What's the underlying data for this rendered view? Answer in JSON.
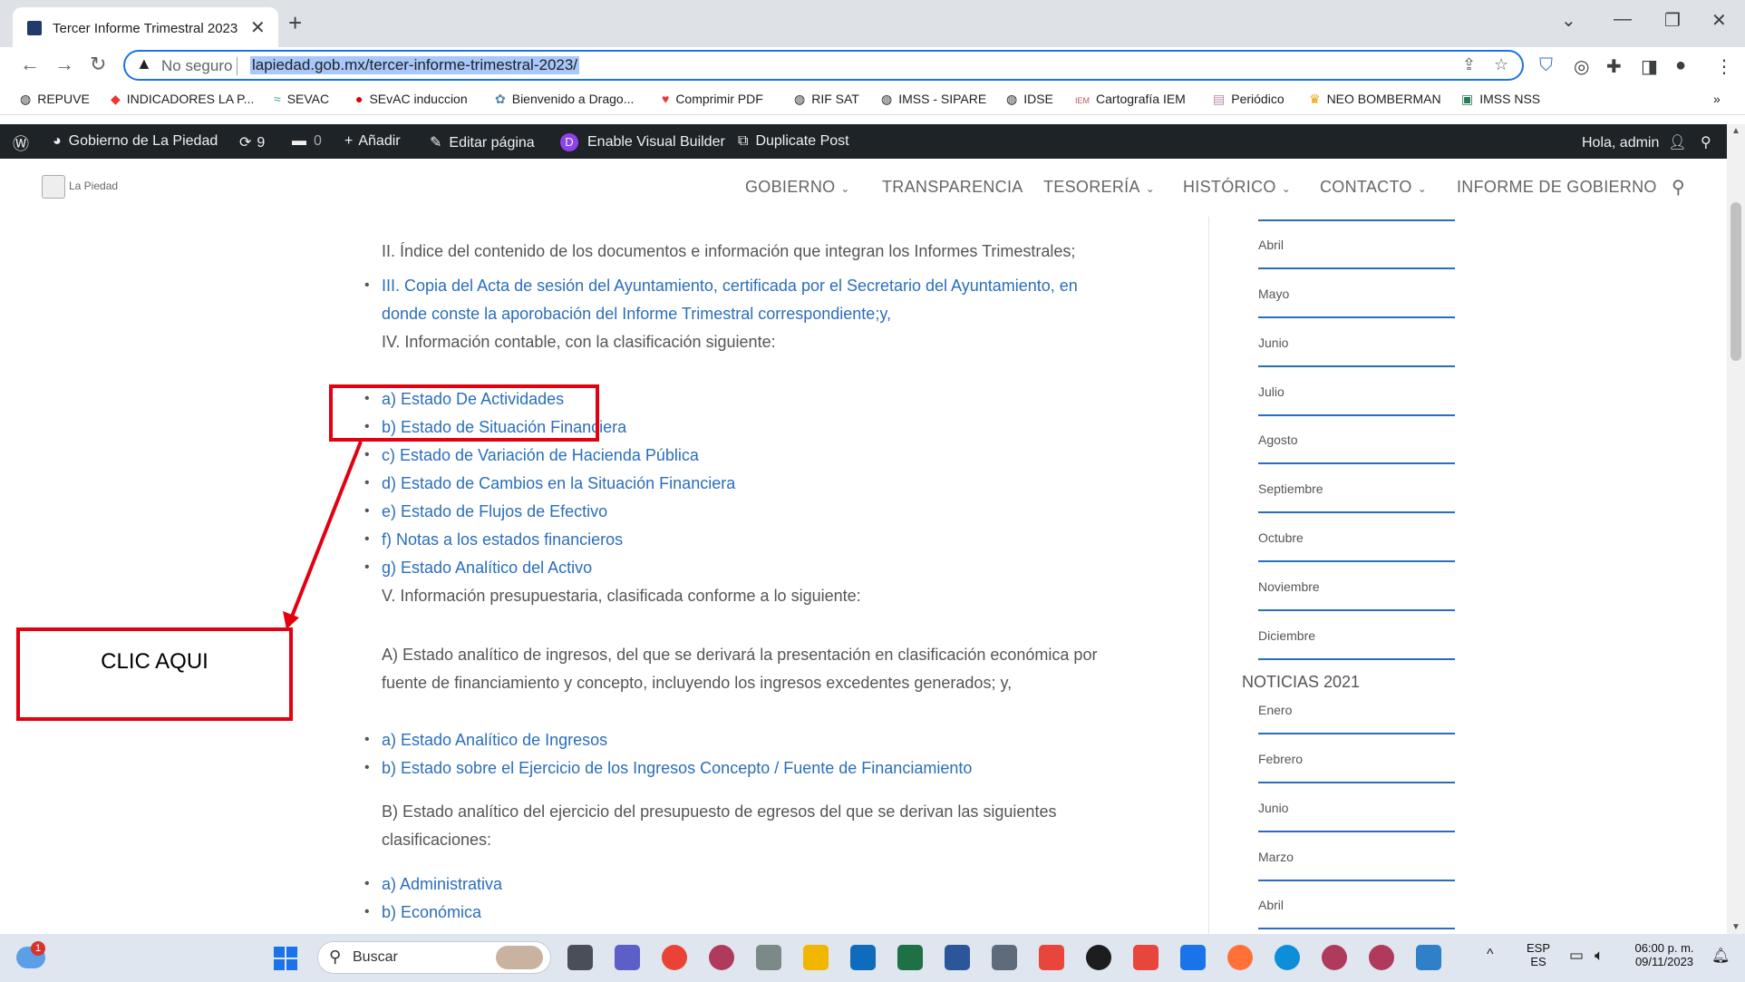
{
  "browser": {
    "tab_title": "Tercer Informe Trimestral 2023 |",
    "security_label": "No seguro",
    "url": "lapiedad.gob.mx/tercer-informe-trimestral-2023/",
    "bookmarks": [
      "REPUVE",
      "INDICADORES LA P...",
      "SEVAC",
      "SEvAC induccion",
      "Bienvenido a Drago...",
      "Comprimir PDF",
      "RIF SAT",
      "IMSS - SIPARE",
      "IDSE",
      "Cartografía IEM",
      "Periódico",
      "NEO BOMBERMAN",
      "IMSS NSS"
    ],
    "bookmarks_overflow": "»"
  },
  "adminbar": {
    "site_name": "Gobierno de La Piedad",
    "updates_count": "9",
    "comments_count": "0",
    "add_new": "Añadir",
    "edit_page": "Editar página",
    "visual_builder": "Enable Visual Builder",
    "duplicate_post": "Duplicate Post",
    "greeting": "Hola, admin"
  },
  "site": {
    "logo_text": "La Piedad",
    "nav": [
      "GOBIERNO",
      "TRANSPARENCIA",
      "TESORERÍA",
      "HISTÓRICO",
      "CONTACTO",
      "INFORME DE GOBIERNO"
    ]
  },
  "content": {
    "p_ii": "II. Índice del contenido de los documentos e información que integran los Informes Trimestrales;",
    "link_iii_line1": "III. Copia del Acta de sesión del Ayuntamiento, certificada por el Secretario del Ayuntamiento, en",
    "link_iii_line2": "donde conste la aporobación del Informe Trimestral correspondiente;y,",
    "p_iv": "IV. Información contable, con la clasificación siguiente:",
    "contable_links": [
      "a) Estado De Actividades",
      "b) Estado de Situación Financiera",
      "c) Estado de Variación de Hacienda Pública",
      "d) Estado de Cambios en la Situación Financiera",
      "e) Estado de Flujos de Efectivo",
      "f) Notas a los estados financieros",
      "g) Estado Analítico del Activo"
    ],
    "p_v": "V. Información presupuestaria, clasificada conforme a lo siguiente:",
    "p_a_line1": "A) Estado analítico de ingresos, del que se derivará la presentación en clasificación económica por",
    "p_a_line2": "fuente de financiamiento y concepto, incluyendo los ingresos excedentes generados; y,",
    "ingresos_links": [
      "a) Estado Analítico de Ingresos",
      "b) Estado sobre el Ejercicio de los Ingresos Concepto / Fuente de Financiamiento"
    ],
    "p_b_line1": "B) Estado analítico del ejercicio del presupuesto de egresos del que se derivan las siguientes",
    "p_b_line2": "clasificaciones:",
    "egresos_links": [
      "a) Administrativa",
      "b) Económica"
    ]
  },
  "sidebar": {
    "months_2023": [
      "Abril",
      "Mayo",
      "Junio",
      "Julio",
      "Agosto",
      "Septiembre",
      "Octubre",
      "Noviembre",
      "Diciembre"
    ],
    "heading_2021": "NOTICIAS 2021",
    "months_2021": [
      "Enero",
      "Febrero",
      "Junio",
      "Marzo",
      "Abril"
    ]
  },
  "annotation": {
    "label": "CLIC AQUI",
    "color": "#e3000f"
  },
  "taskbar": {
    "search_placeholder": "Buscar",
    "weather_badge": "1",
    "lang_top": "ESP",
    "lang_bottom": "ES",
    "time": "06:00 p. m.",
    "date": "09/11/2023"
  }
}
